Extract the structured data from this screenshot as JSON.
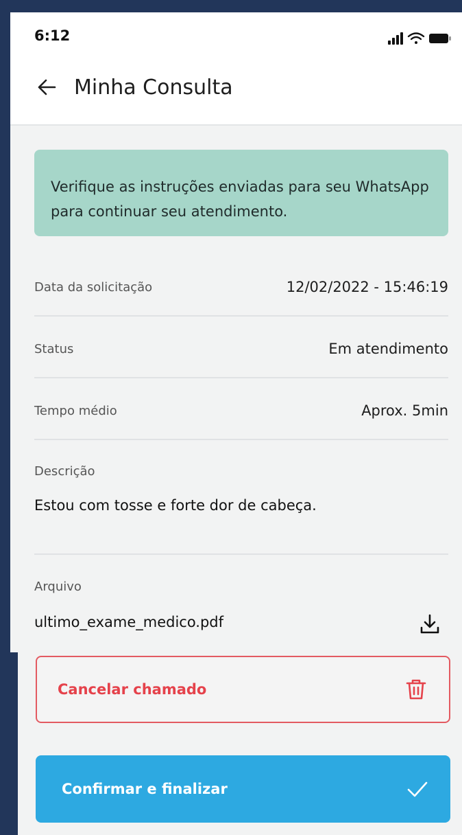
{
  "status_bar": {
    "time": "6:12"
  },
  "header": {
    "title": "Minha Consulta"
  },
  "banner": {
    "text": "Verifique as instruções enviadas para seu WhatsApp para continuar seu atendimento."
  },
  "details": {
    "date_label": "Data da solicitação",
    "date_value": "12/02/2022 - 15:46:19",
    "status_label": "Status",
    "status_value": "Em atendimento",
    "time_label": "Tempo médio",
    "time_value": "Aprox. 5min",
    "description_label": "Descrição",
    "description_value": "Estou com tosse e forte dor de cabeça.",
    "file_label": "Arquivo",
    "file_name": "ultimo_exame_medico.pdf"
  },
  "actions": {
    "cancel_label": "Cancelar chamado",
    "confirm_label": "Confirmar e finalizar"
  },
  "icons": {
    "back": "arrow-left-icon",
    "download": "download-icon",
    "trash": "trash-icon",
    "check": "check-icon"
  },
  "colors": {
    "background": "#22365a",
    "banner": "#a6d6c9",
    "cancel": "#e5424b",
    "confirm": "#2da9e1"
  }
}
